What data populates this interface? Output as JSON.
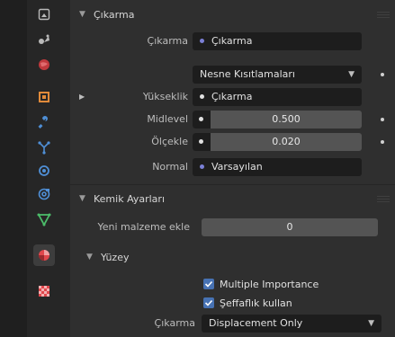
{
  "sidebar": {
    "tools": [
      {
        "icon": "render-icon"
      },
      {
        "icon": "scene-icon"
      },
      {
        "icon": "world-icon"
      },
      {
        "icon": "object-icon"
      },
      {
        "icon": "modifier-wrench-icon"
      },
      {
        "icon": "particles-icon"
      },
      {
        "icon": "physics-icon"
      },
      {
        "icon": "constraints-icon"
      },
      {
        "icon": "object-data-icon"
      },
      {
        "icon": "material-icon"
      },
      {
        "icon": "texture-icon"
      }
    ]
  },
  "cikarma_panel": {
    "title": "Çıkarma",
    "cikarma_label": "Çıkarma",
    "cikarma_value": "Çıkarma",
    "space_dropdown": "Nesne Kısıtlamaları",
    "yukseklik_label": "Yükseklik",
    "yukseklik_value": "Çıkarma",
    "midlevel_label": "Midlevel",
    "midlevel_value": "0.500",
    "olcekle_label": "Ölçekle",
    "olcekle_value": "0.020",
    "normal_label": "Normal",
    "normal_value": "Varsayılan"
  },
  "kemik_panel": {
    "title": "Kemik Ayarları",
    "yeni_malzeme_label": "Yeni malzeme ekle",
    "yeni_malzeme_value": "0"
  },
  "yuzey_panel": {
    "title": "Yüzey",
    "multiple_importance": "Multiple Importance",
    "multiple_importance_checked": true,
    "seffaflik": "Şeffaflık kullan",
    "seffaflik_checked": true,
    "cikarma_label": "Çıkarma",
    "cikarma_value": "Displacement Only"
  },
  "colors": {
    "accent": "#4772b3",
    "socket_purple": "#7b80d6",
    "active_material": "#e0474c"
  }
}
